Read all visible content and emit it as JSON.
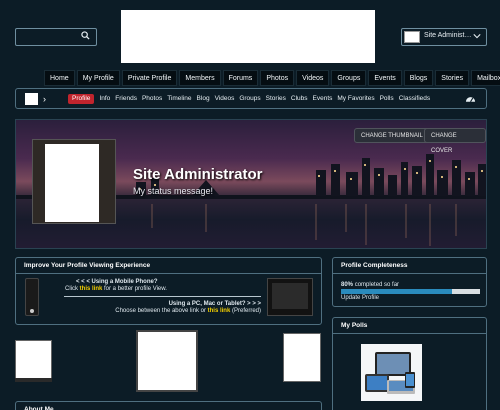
{
  "header": {
    "search": {
      "placeholder": ""
    },
    "user": {
      "name": "Site Administ…"
    }
  },
  "topnav": [
    "Home",
    "My Profile",
    "Private Profile",
    "Members",
    "Forums",
    "Photos",
    "Videos",
    "Groups",
    "Events",
    "Blogs",
    "Stories",
    "Mailbox"
  ],
  "subnav": {
    "active": "Profile",
    "links": [
      "Info",
      "Friends",
      "Photos",
      "Timeline",
      "Blog",
      "Videos",
      "Groups",
      "Stories",
      "Clubs",
      "Events",
      "My Favorites",
      "Polls",
      "Classifieds"
    ]
  },
  "cover": {
    "change_thumbnail": "CHANGE THUMBNAIL",
    "change_cover": "CHANGE COVER",
    "name": "Site Administrator",
    "status": "My status message!"
  },
  "improve": {
    "title": "Improve Your Profile Viewing Experience",
    "mobile_q": "< < < Using a Mobile Phone?",
    "mobile_click": "Click",
    "mobile_link": "this link",
    "mobile_rest": "for a better profile View.",
    "pc_q": "Using a PC, Mac  or Tablet? > > >",
    "pc_choose": "Choose between the above link or",
    "pc_link": "this link",
    "pc_pref": "(Preferred)"
  },
  "completeness": {
    "title": "Profile Completeness",
    "percent_label": "80%",
    "percent_rest": "completed so far",
    "percent": 80,
    "update": "Update Profile"
  },
  "polls": {
    "title": "My Polls"
  },
  "about": {
    "title": "About Me"
  },
  "colors": {
    "accent_red": "#c0242d",
    "link_yellow": "#f5d000",
    "progress_blue": "#2a8bbd",
    "panel_border": "#4f6f80",
    "bg": "#0c1c26"
  },
  "icons": [
    "search-icon",
    "chevron-down-icon",
    "hamburger-icon",
    "chevron-right-icon",
    "dashboard-gauge-icon"
  ]
}
